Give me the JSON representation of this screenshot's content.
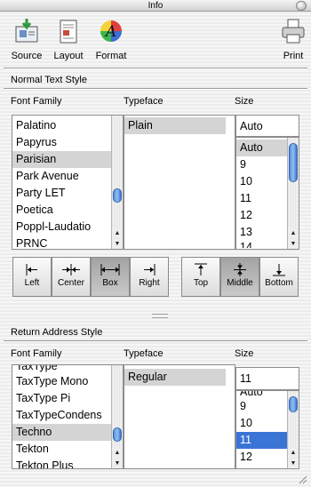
{
  "window": {
    "title": "Info"
  },
  "toolbar": {
    "source": "Source",
    "layout": "Layout",
    "format": "Format",
    "print": "Print"
  },
  "normal": {
    "section_title": "Normal Text Style",
    "font_family_label": "Font Family",
    "typeface_label": "Typeface",
    "size_label": "Size",
    "fonts": [
      "Palatino",
      "Papyrus",
      "Parisian",
      "Park Avenue",
      "Party LET",
      "Poetica",
      "Poppl-Laudatio",
      "PRNC"
    ],
    "typefaces": [
      "Plain"
    ],
    "size_value": "Auto",
    "sizes": [
      "Auto",
      "9",
      "10",
      "11",
      "12",
      "13",
      "14"
    ]
  },
  "alignment": {
    "left": "Left",
    "center": "Center",
    "box": "Box",
    "right": "Right"
  },
  "vertical": {
    "top": "Top",
    "middle": "Middle",
    "bottom": "Bottom"
  },
  "ret": {
    "section_title": "Return Address Style",
    "font_family_label": "Font Family",
    "typeface_label": "Typeface",
    "size_label": "Size",
    "fonts": [
      "TaxType",
      "TaxType Mono",
      "TaxType Pi",
      "TaxTypeCondens",
      "Techno",
      "Tekton",
      "Tekton Plus"
    ],
    "typefaces": [
      "Regular"
    ],
    "size_value": "11",
    "sizes": [
      "Auto",
      "9",
      "10",
      "11",
      "12"
    ]
  }
}
